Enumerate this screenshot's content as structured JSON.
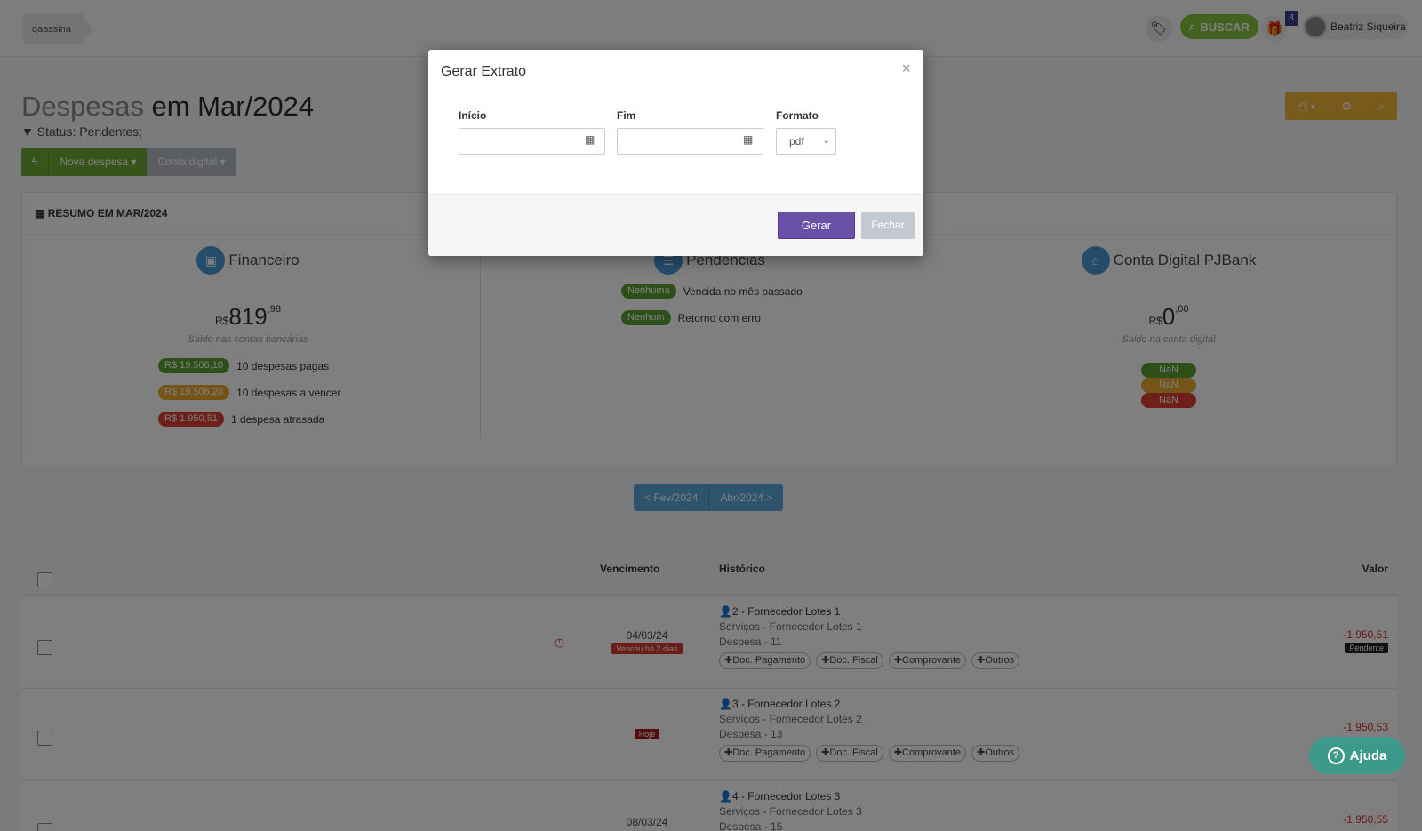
{
  "breadcrumb": "qaassina",
  "topbar": {
    "buscar": "BUSCAR",
    "gift_count": "8",
    "user_name": "Beatriz Siqueira",
    "tag_icon": "🏷",
    "gift_icon": "🎁"
  },
  "page": {
    "title_prefix": "Despesas",
    "title_suffix": "em Mar/2024",
    "status": "Status: Pendentes;"
  },
  "actions": {
    "bolt": "ϟ",
    "nova": "Nova despesa ▾",
    "conta": "Conta digital ▾"
  },
  "right_tools": {
    "print": "⎙ ▾",
    "gear": "⚙",
    "search": "⌕"
  },
  "summary": {
    "header": "RESUMO EM MAR/2024",
    "financeiro": {
      "title": "Financeiro",
      "currency": "R$",
      "amount": "819",
      "cents": ",98",
      "subtitle": "Saldo nas contas bancárias",
      "rows": [
        {
          "pill": "R$ 19.506,10",
          "text": "10 despesas pagas"
        },
        {
          "pill": "R$ 19.506,20",
          "text": "10 despesas a vencer"
        },
        {
          "pill": "R$ 1.950,51",
          "text": "1 despesa atrasada"
        }
      ]
    },
    "pendencias": {
      "title": "Pendências",
      "rows": [
        {
          "pill": "Nenhuma",
          "text": "Vencida no mês passado"
        },
        {
          "pill": "Nenhum",
          "text": "Retorno com erro"
        }
      ]
    },
    "conta_digital": {
      "title": "Conta Digital PJBank",
      "currency": "R$",
      "amount": "0",
      "cents": ",00",
      "subtitle": "Saldo na conta digital",
      "pills": [
        "NaN",
        "NaN",
        "NaN"
      ]
    }
  },
  "pager": {
    "prev": "< Fev/2024",
    "next": "Abr/2024 >"
  },
  "table": {
    "headers": {
      "vencimento": "Vencimento",
      "historico": "Histórico",
      "valor": "Valor"
    },
    "docs": [
      "✚Doc. Pagamento",
      "✚Doc. Fiscal",
      "✚Comprovante",
      "✚Outros"
    ],
    "rows": [
      {
        "date": "04/03/24",
        "tag": "Venceu há 2 dias",
        "title": "2 - Fornecedor Lotes 1",
        "service": "Serviços - Fornecedor Lotes 1",
        "expense": "Despesa - 11",
        "value": "-1.950,51",
        "status": "Pendente"
      },
      {
        "date": "",
        "tag": "Hoje",
        "title": "3 - Fornecedor Lotes 2",
        "service": "Serviços - Fornecedor Lotes 2",
        "expense": "Despesa - 13",
        "value": "-1.950,53",
        "status": ""
      },
      {
        "date": "08/03/24",
        "tag": "",
        "title": "4 - Fornecedor Lotes 3",
        "service": "Serviços - Fornecedor Lotes 3",
        "expense": "Despesa - 15",
        "value": "-1.950,55",
        "status": ""
      }
    ]
  },
  "modal": {
    "title": "Gerar Extrato",
    "close": "×",
    "inicio_label": "Início",
    "fim_label": "Fim",
    "formato_label": "Formato",
    "formato_value": "pdf",
    "inicio_value": "",
    "fim_value": "",
    "gerar": "Gerar",
    "fechar": "Fechar"
  },
  "help": {
    "label": "Ajuda"
  }
}
